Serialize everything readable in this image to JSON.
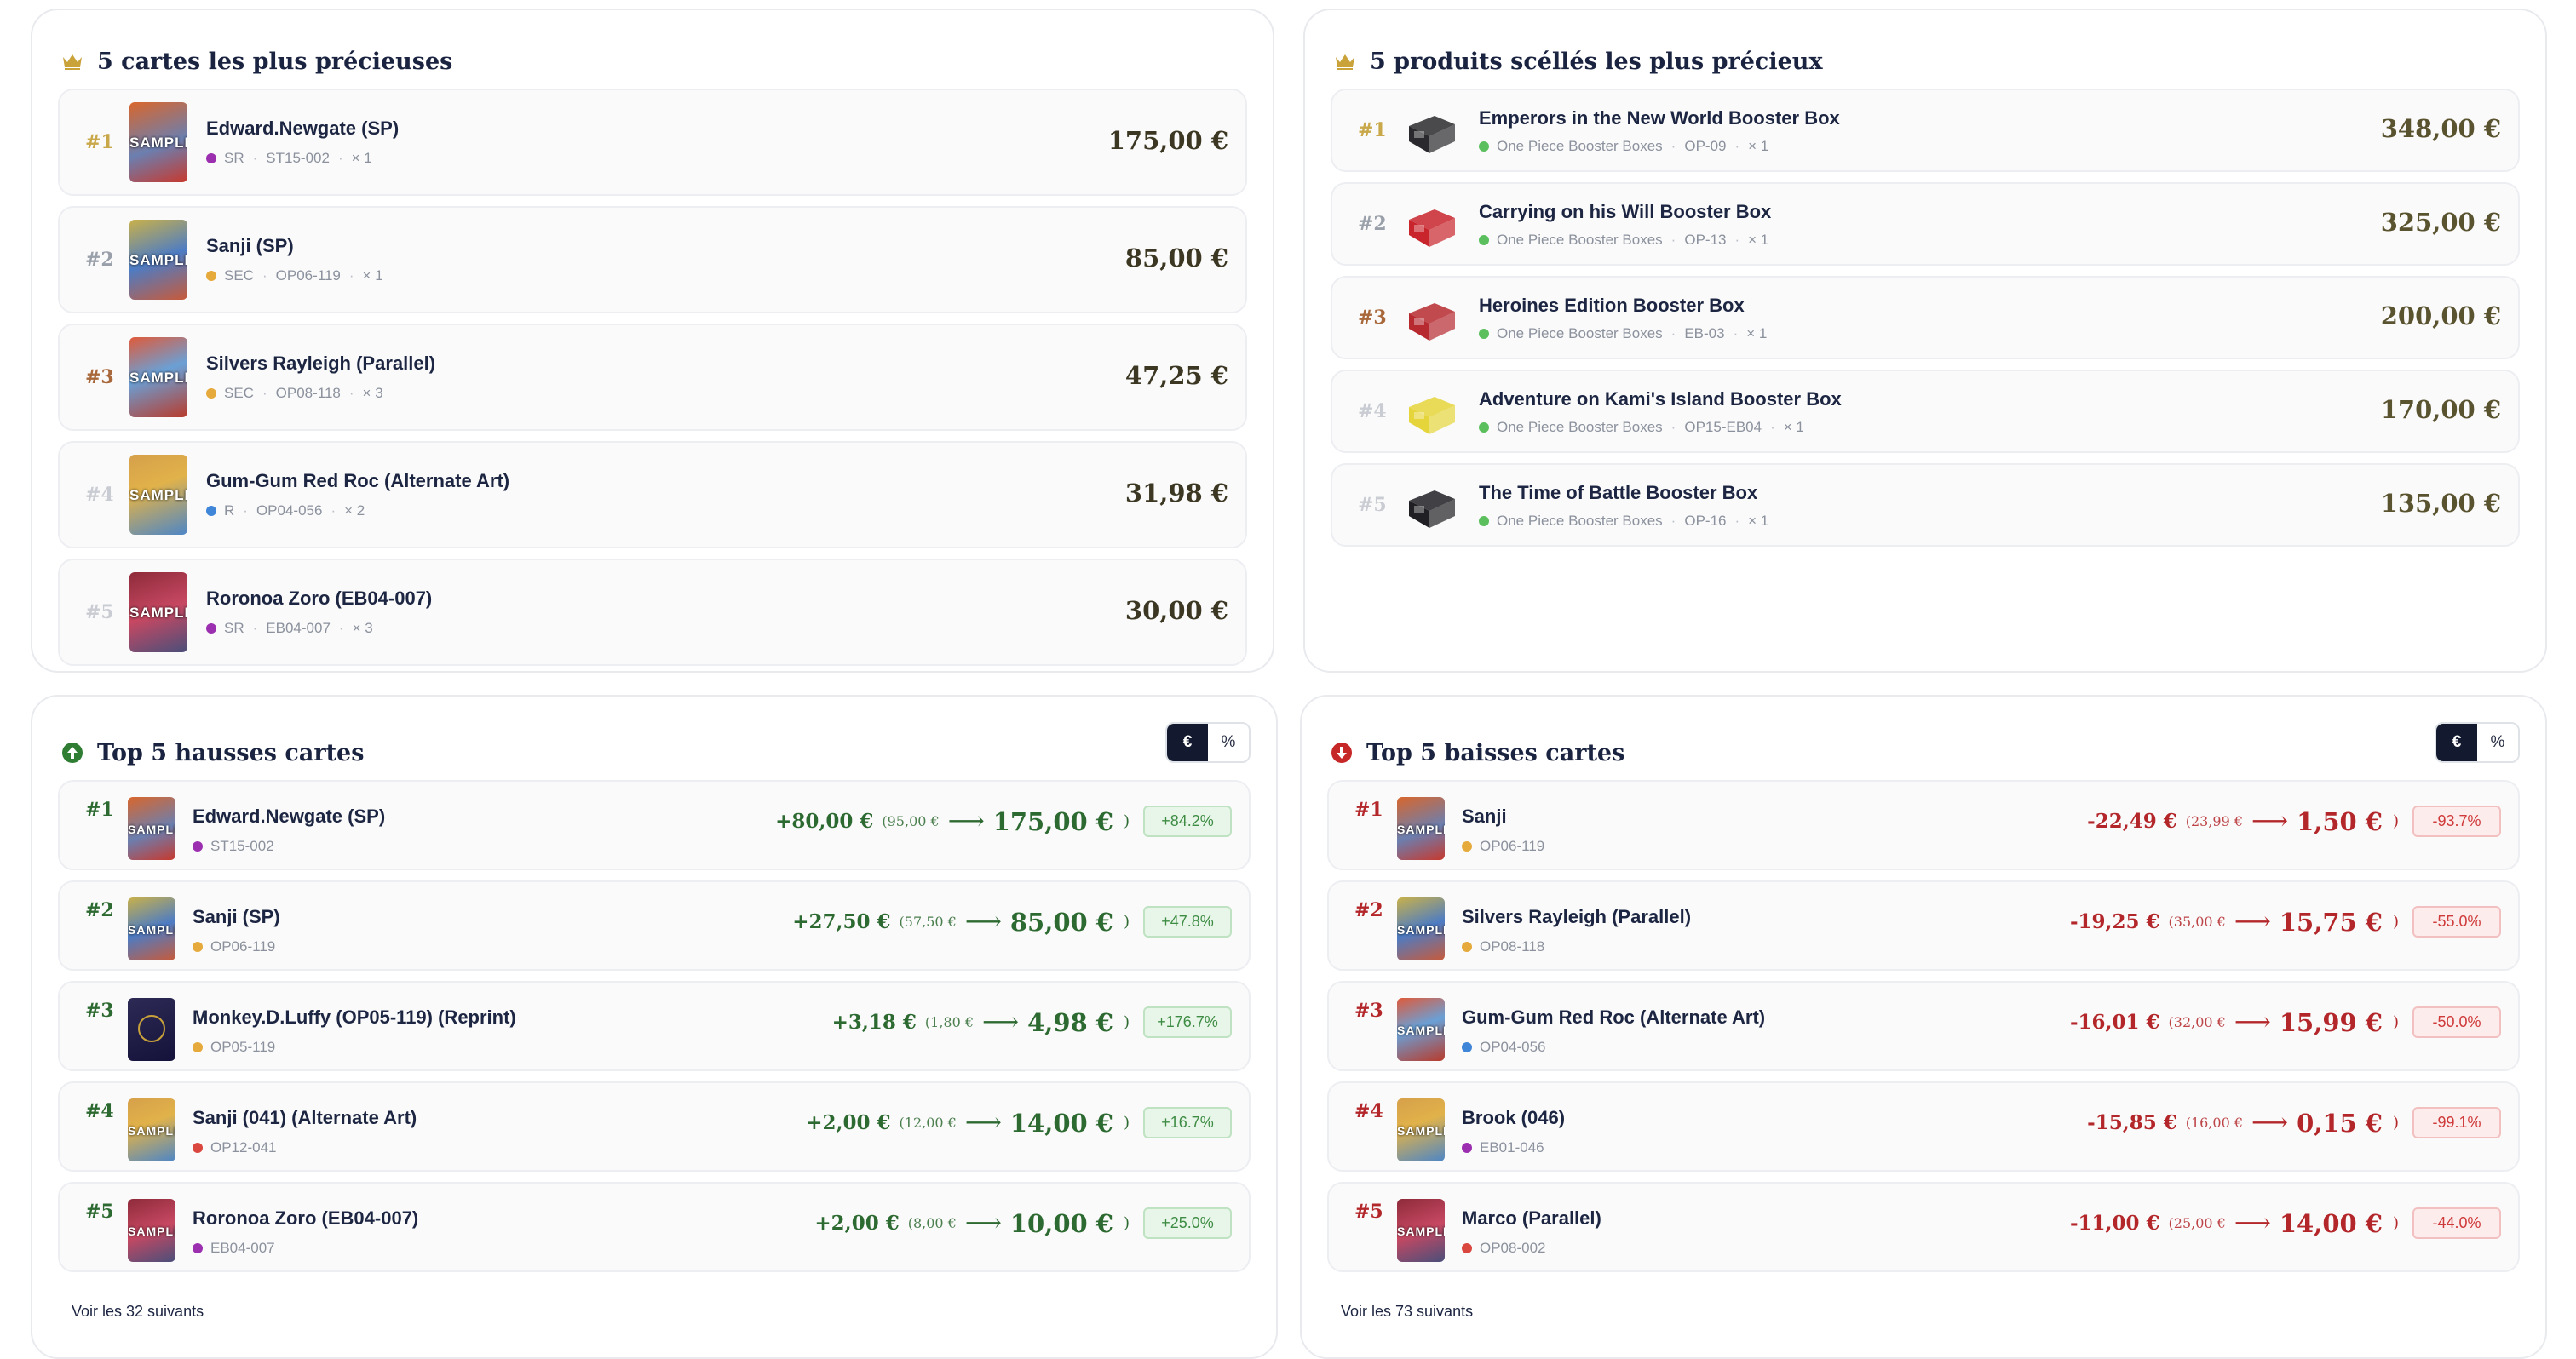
{
  "cards_panel": {
    "title": "5 cartes les plus précieuses",
    "icon": "crown-icon",
    "items": [
      {
        "rank": "#1",
        "name": "Edward.Newgate (SP)",
        "rarity": "SR",
        "rarity_color": "#9b2fb0",
        "code": "ST15-002",
        "qty": "× 1",
        "price": "175,00 €",
        "rank_color": "#c9a84a",
        "thumb": "SAMPLE"
      },
      {
        "rank": "#2",
        "name": "Sanji (SP)",
        "rarity": "SEC",
        "rarity_color": "#e6a93b",
        "code": "OP06-119",
        "qty": "× 1",
        "price": "85,00 €",
        "rank_color": "#9aa0aa",
        "thumb": "SAMPLE"
      },
      {
        "rank": "#3",
        "name": "Silvers Rayleigh (Parallel)",
        "rarity": "SEC",
        "rarity_color": "#e6a93b",
        "code": "OP08-118",
        "qty": "× 3",
        "price": "47,25 €",
        "rank_color": "#a8683b",
        "thumb": "SAMPLE"
      },
      {
        "rank": "#4",
        "name": "Gum-Gum Red Roc (Alternate Art)",
        "rarity": "R",
        "rarity_color": "#3f86d9",
        "code": "OP04-056",
        "qty": "× 2",
        "price": "31,98 €",
        "rank_color": "#c9ccd2",
        "thumb": "SAMPLE"
      },
      {
        "rank": "#5",
        "name": "Roronoa Zoro (EB04-007)",
        "rarity": "SR",
        "rarity_color": "#9b2fb0",
        "code": "EB04-007",
        "qty": "× 3",
        "price": "30,00 €",
        "rank_color": "#c9ccd2",
        "thumb": "SAMPLE"
      }
    ]
  },
  "sealed_panel": {
    "title": "5 produits scéllés les plus précieux",
    "icon": "crown-icon",
    "items": [
      {
        "rank": "#1",
        "name": "Emperors in the New World Booster Box",
        "category": "One Piece Booster Boxes",
        "code": "OP-09",
        "qty": "× 1",
        "price": "348,00 €",
        "rank_color": "#c9a84a",
        "box_color": "#2a2a2e"
      },
      {
        "rank": "#2",
        "name": "Carrying on his Will Booster Box",
        "category": "One Piece Booster Boxes",
        "code": "OP-13",
        "qty": "× 1",
        "price": "325,00 €",
        "rank_color": "#9aa0aa",
        "box_color": "#c8252c"
      },
      {
        "rank": "#3",
        "name": "Heroines Edition Booster Box",
        "category": "One Piece Booster Boxes",
        "code": "EB-03",
        "qty": "× 1",
        "price": "200,00 €",
        "rank_color": "#a8683b",
        "box_color": "#b62a30"
      },
      {
        "rank": "#4",
        "name": "Adventure on Kami's Island Booster Box",
        "category": "One Piece Booster Boxes",
        "code": "OP15-EB04",
        "qty": "× 1",
        "price": "170,00 €",
        "rank_color": "#c9ccd2",
        "box_color": "#e5d53b"
      },
      {
        "rank": "#5",
        "name": "The Time of Battle Booster Box",
        "category": "One Piece Booster Boxes",
        "code": "OP-16",
        "qty": "× 1",
        "price": "135,00 €",
        "rank_color": "#c9ccd2",
        "box_color": "#1f1f24"
      }
    ]
  },
  "up_panel": {
    "title": "Top 5 hausses cartes",
    "icon": "arrow-up-circle-icon",
    "toggle": {
      "euro": "€",
      "percent": "%",
      "active": "euro"
    },
    "items": [
      {
        "rank": "#1",
        "name": "Edward.Newgate (SP)",
        "code": "ST15-002",
        "dot_color": "#9b2fb0",
        "diff": "+80,00 €",
        "old": "(95,00 €",
        "arrow": "⟶",
        "new": "175,00 €",
        "close": ")",
        "pct": "+84.2%",
        "thumb": "SAMPLE"
      },
      {
        "rank": "#2",
        "name": "Sanji (SP)",
        "code": "OP06-119",
        "dot_color": "#e6a93b",
        "diff": "+27,50 €",
        "old": "(57,50 €",
        "arrow": "⟶",
        "new": "85,00 €",
        "close": ")",
        "pct": "+47.8%",
        "thumb": "SAMPLE"
      },
      {
        "rank": "#3",
        "name": "Monkey.D.Luffy (OP05-119) (Reprint)",
        "code": "OP05-119",
        "dot_color": "#e6a93b",
        "diff": "+3,18 €",
        "old": "(1,80 €",
        "arrow": "⟶",
        "new": "4,98 €",
        "close": ")",
        "pct": "+176.7%",
        "thumb": ""
      },
      {
        "rank": "#4",
        "name": "Sanji (041) (Alternate Art)",
        "code": "OP12-041",
        "dot_color": "#d9473f",
        "diff": "+2,00 €",
        "old": "(12,00 €",
        "arrow": "⟶",
        "new": "14,00 €",
        "close": ")",
        "pct": "+16.7%",
        "thumb": "SAMPLE"
      },
      {
        "rank": "#5",
        "name": "Roronoa Zoro (EB04-007)",
        "code": "EB04-007",
        "dot_color": "#9b2fb0",
        "diff": "+2,00 €",
        "old": "(8,00 €",
        "arrow": "⟶",
        "new": "10,00 €",
        "close": ")",
        "pct": "+25.0%",
        "thumb": "SAMPLE"
      }
    ],
    "more": "Voir les 32 suivants"
  },
  "down_panel": {
    "title": "Top 5 baisses cartes",
    "icon": "arrow-down-circle-icon",
    "toggle": {
      "euro": "€",
      "percent": "%",
      "active": "euro"
    },
    "items": [
      {
        "rank": "#1",
        "name": "Sanji",
        "code": "OP06-119",
        "dot_color": "#e6a93b",
        "diff": "-22,49 €",
        "old": "(23,99 €",
        "arrow": "⟶",
        "new": "1,50 €",
        "close": ")",
        "pct": "-93.7%",
        "thumb": "SAMPLE"
      },
      {
        "rank": "#2",
        "name": "Silvers Rayleigh (Parallel)",
        "code": "OP08-118",
        "dot_color": "#e6a93b",
        "diff": "-19,25 €",
        "old": "(35,00 €",
        "arrow": "⟶",
        "new": "15,75 €",
        "close": ")",
        "pct": "-55.0%",
        "thumb": "SAMPLE"
      },
      {
        "rank": "#3",
        "name": "Gum-Gum Red Roc (Alternate Art)",
        "code": "OP04-056",
        "dot_color": "#3f86d9",
        "diff": "-16,01 €",
        "old": "(32,00 €",
        "arrow": "⟶",
        "new": "15,99 €",
        "close": ")",
        "pct": "-50.0%",
        "thumb": "SAMPLE"
      },
      {
        "rank": "#4",
        "name": "Brook (046)",
        "code": "EB01-046",
        "dot_color": "#9b2fb0",
        "diff": "-15,85 €",
        "old": "(16,00 €",
        "arrow": "⟶",
        "new": "0,15 €",
        "close": ")",
        "pct": "-99.1%",
        "thumb": "SAMPLE"
      },
      {
        "rank": "#5",
        "name": "Marco (Parallel)",
        "code": "OP08-002",
        "dot_color": "#d9473f",
        "diff": "-11,00 €",
        "old": "(25,00 €",
        "arrow": "⟶",
        "new": "14,00 €",
        "close": ")",
        "pct": "-44.0%",
        "thumb": "SAMPLE"
      }
    ],
    "more": "Voir les 73 suivants"
  }
}
